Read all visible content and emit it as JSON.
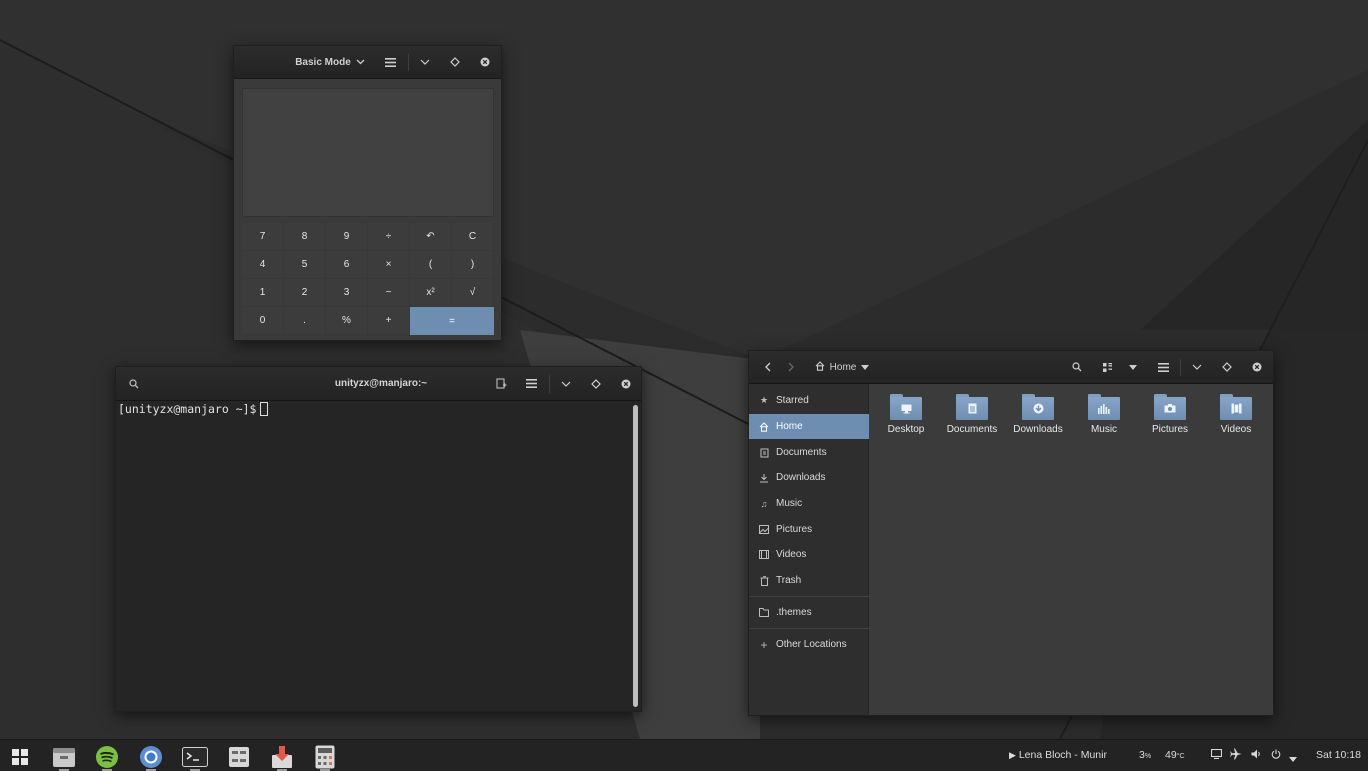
{
  "calculator": {
    "mode": "Basic Mode",
    "mode_chevron": "chevron-down-icon",
    "keys": [
      "7",
      "8",
      "9",
      "÷",
      "↶",
      "C",
      "4",
      "5",
      "6",
      "×",
      "(",
      ")",
      "1",
      "2",
      "3",
      "−",
      "x²",
      "√",
      "0",
      ".",
      "%",
      "+",
      "="
    ]
  },
  "terminal": {
    "title": "unityzx@manjaro:~",
    "prompt": "[unityzx@manjaro ~]$"
  },
  "files": {
    "location": "Home",
    "sidebar": [
      {
        "label": "Starred",
        "icon": "star-icon"
      },
      {
        "label": "Home",
        "icon": "home-icon"
      },
      {
        "label": "Documents",
        "icon": "documents-icon"
      },
      {
        "label": "Downloads",
        "icon": "downloads-icon"
      },
      {
        "label": "Music",
        "icon": "music-icon"
      },
      {
        "label": "Pictures",
        "icon": "pictures-icon"
      },
      {
        "label": "Videos",
        "icon": "videos-icon"
      },
      {
        "label": "Trash",
        "icon": "trash-icon"
      },
      {
        "label": ".themes",
        "icon": "folder-icon"
      },
      {
        "label": "Other Locations",
        "icon": "plus-icon"
      }
    ],
    "folders": [
      {
        "label": "Desktop",
        "icon": "desktop-icon"
      },
      {
        "label": "Documents",
        "icon": "documents-icon"
      },
      {
        "label": "Downloads",
        "icon": "downloads-icon"
      },
      {
        "label": "Music",
        "icon": "music-icon"
      },
      {
        "label": "Pictures",
        "icon": "pictures-icon"
      },
      {
        "label": "Videos",
        "icon": "videos-icon"
      }
    ]
  },
  "taskbar": {
    "apps": [
      "app-grid-icon",
      "files-icon",
      "spotify-icon",
      "chromium-icon",
      "terminal-icon",
      "settings-icon",
      "installer-icon",
      "calculator-icon"
    ],
    "now_playing": "Lena Bloch - Munir",
    "cpu": "3",
    "cpu_unit": "%",
    "temp": "49",
    "temp_unit": "°C",
    "clock": "Sat 10:18"
  },
  "colors": {
    "accent": "#6d8db1",
    "titlebar": "#262626",
    "panel": "#232323"
  }
}
